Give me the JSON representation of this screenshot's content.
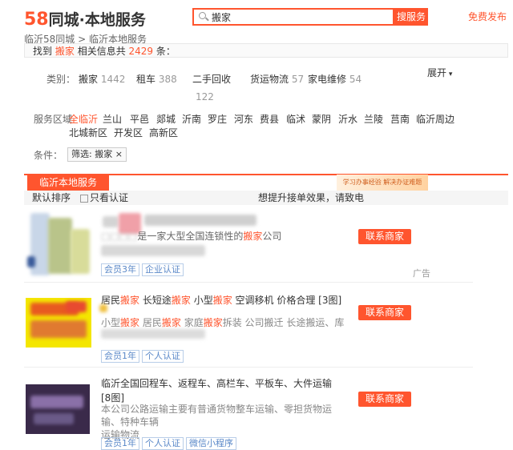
{
  "header": {
    "logo_num": "58",
    "logo_text": "同城·本地服务",
    "search_value": "搬家",
    "search_button": "搜服务",
    "publish": "免费发布"
  },
  "breadcrumb": {
    "a": "临沂58同城",
    "sep": ">",
    "b": "临沂本地服务"
  },
  "found": {
    "pre": "找到",
    "keyword": "搬家",
    "mid": "相关信息共",
    "count": "2429",
    "post": "条："
  },
  "category": {
    "label": "类别：",
    "items": [
      {
        "name": "搬家",
        "num": "1442"
      },
      {
        "name": "租车",
        "num": "388"
      },
      {
        "name": "二手回收",
        "num": "122"
      },
      {
        "name": "货运物流",
        "num": "57"
      },
      {
        "name": "家电维修",
        "num": "54"
      }
    ],
    "expand": "展开"
  },
  "area": {
    "label": "服务区域",
    "active": "全临沂",
    "items": [
      "兰山",
      "平邑",
      "郯城",
      "沂南",
      "罗庄",
      "河东",
      "费县",
      "临沭",
      "蒙阴",
      "沂水",
      "兰陵",
      "莒南",
      "临沂周边",
      "北城新区",
      "开发区",
      "高新区"
    ]
  },
  "condition": {
    "label": "条件：",
    "tag": "筛选: 搬家 ×"
  },
  "tab": {
    "label": "临沂本地服务",
    "banner": "学习办事经验  解决办证难题"
  },
  "sort": {
    "default": "默认排序",
    "verified": "只看认证",
    "promo": "想提升接单效果，请致电"
  },
  "listings": [
    {
      "title_a": "",
      "title_b": "是一家大型全国连锁性的",
      "title_hl": "搬家",
      "title_c": "公司",
      "tags": [
        "会员3年",
        "企业认证"
      ],
      "contact": "联系商家",
      "ad": "广告"
    },
    {
      "title_p1": "居民",
      "title_h1": "搬家",
      "title_p2": " 长短途",
      "title_h2": "搬家",
      "title_p3": " 小型",
      "title_h3": "搬家",
      "title_p4": " 空调移机 价格合理 [3图]",
      "desc_p1": "小型",
      "desc_h1": "搬家",
      "desc_p2": " 居民",
      "desc_h2": "搬家",
      "desc_p3": " 家庭",
      "desc_h3": "搬家",
      "desc_p4": "拆装 公司搬迁 长途搬运、库",
      "tags": [
        "会员1年",
        "个人认证"
      ],
      "contact": "联系商家"
    },
    {
      "title_l1": "临沂全国回程车、返程车、高栏车、平板车、大件运输",
      "title_l2": "[8图]",
      "desc_l1": "本公司公路运输主要有普通货物整车运输、零担货物运",
      "desc_l2": "输、特种车辆",
      "desc_l3": "运输物流",
      "tags": [
        "会员1年",
        "个人认证",
        "微信小程序"
      ],
      "contact": "联系商家"
    }
  ]
}
